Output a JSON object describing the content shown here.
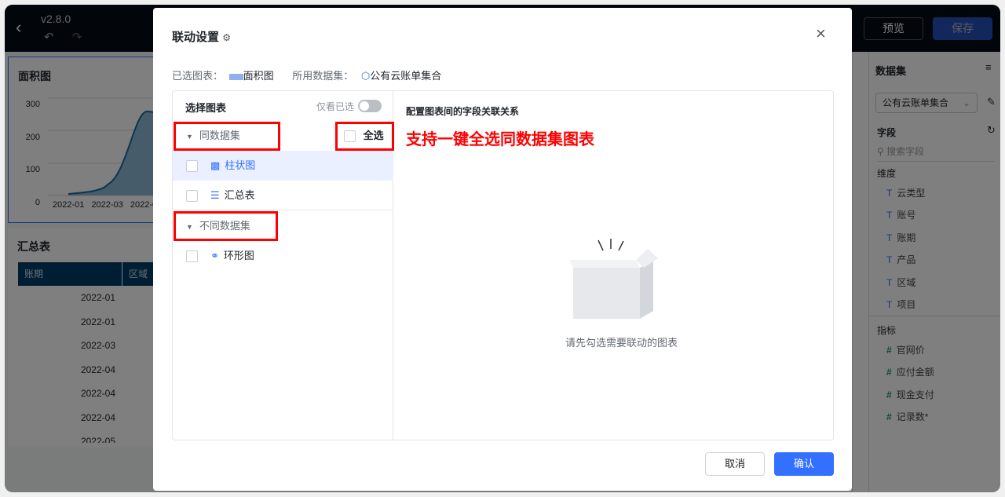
{
  "topbar": {
    "version": "v2.8.0",
    "preview": "预览",
    "save": "保存"
  },
  "canvas": {
    "area_chart": {
      "title": "面积图",
      "yticks": [
        "300",
        "200",
        "100",
        "0"
      ],
      "xticks": [
        "2022-01",
        "2022-03",
        "2022-0"
      ]
    },
    "table": {
      "title": "汇总表",
      "columns": [
        "账期",
        "区域"
      ],
      "rows": [
        "2022-01",
        "2022-01",
        "2022-03",
        "2022-04",
        "2022-04",
        "2022-04",
        "2022-05"
      ]
    }
  },
  "dataset_panel": {
    "title": "数据集",
    "selected": "公有云账单集合",
    "fields_label": "字段",
    "search_placeholder": "搜索字段",
    "dimensions_label": "维度",
    "dimensions": [
      "云类型",
      "账号",
      "账期",
      "产品",
      "区域",
      "项目"
    ],
    "measures_label": "指标",
    "measures": [
      "官网价",
      "应付金额",
      "现金支付",
      "记录数*"
    ]
  },
  "modal": {
    "title": "联动设置",
    "selected_chart_label": "已选图表：",
    "selected_chart": "面积图",
    "dataset_label": "所用数据集：",
    "dataset": "公有云账单集合",
    "left": {
      "title": "选择图表",
      "only_selected": "仅看已选",
      "only_selected_on": false,
      "group_same": "同数据集",
      "select_all": "全选",
      "same_items": [
        {
          "label": "柱状图",
          "icon": "bar-chart-icon"
        },
        {
          "label": "汇总表",
          "icon": "table-icon"
        }
      ],
      "group_diff": "不同数据集",
      "diff_items": [
        {
          "label": "环形图",
          "icon": "donut-chart-icon"
        }
      ]
    },
    "right": {
      "title": "配置图表间的字段关联关系",
      "annotation": "支持一键全选同数据集图表",
      "empty": "请先勾选需要联动的图表"
    },
    "cancel": "取消",
    "confirm": "确认"
  },
  "colors": {
    "accent": "#3370ff",
    "annotation": "#ff0000",
    "header": "#003d66"
  }
}
